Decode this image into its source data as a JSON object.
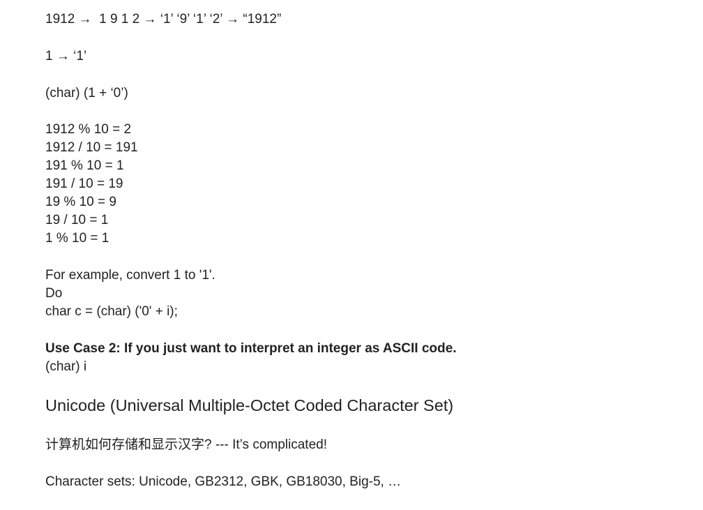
{
  "document": {
    "lines": [
      "1912 →  1 9 1 2 → ‘1’ ‘9’ ‘1’ ‘2’ → “1912”",
      "1 → ‘1’",
      "(char) (1 + ‘0’)",
      "1912 % 10 = 2",
      "1912 / 10 = 191",
      "191 % 10 = 1",
      "191 / 10 = 19",
      "19 % 10 = 9",
      "19 / 10 = 1",
      "1 % 10 = 1",
      "For example, convert 1 to '1'.",
      "Do",
      "char c = (char) ('0' + i);",
      "Use Case 2: If you just want to interpret an integer as ASCII code.",
      "(char) i",
      "Unicode (Universal Multiple-Octet Coded Character Set)",
      "计算机如何存储和显示汉字? --- It’s complicated!",
      "Character sets: Unicode, GB2312, GBK, GB18030, Big-5, …"
    ]
  }
}
